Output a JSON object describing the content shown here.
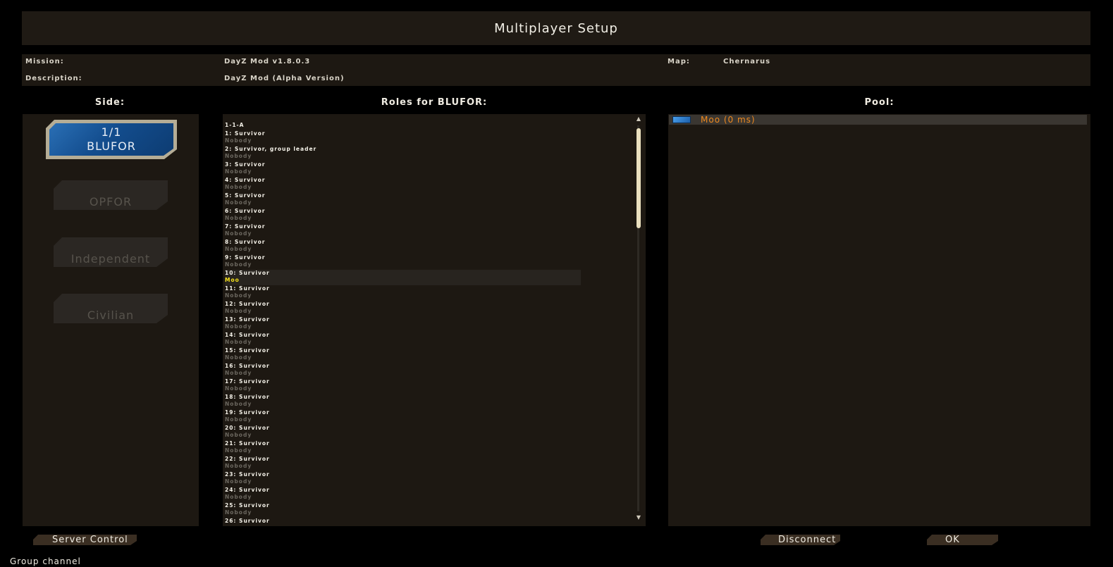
{
  "window": {
    "title": "Multiplayer Setup"
  },
  "info": {
    "mission_label": "Mission:",
    "mission_value": "DayZ Mod v1.8.0.3",
    "description_label": "Description:",
    "description_value": "DayZ Mod (Alpha Version)",
    "map_label": "Map:",
    "map_value": "Chernarus"
  },
  "side_panel": {
    "header": "Side:",
    "blufor": {
      "count": "1/1",
      "label": "BLUFOR"
    },
    "opfor": "OPFOR",
    "independent": "Independent",
    "civilian": "Civilian"
  },
  "roles_panel": {
    "header": "Roles for BLUFOR:",
    "group": "1-1-A",
    "roles": [
      {
        "name": "1: Survivor",
        "player": "Nobody"
      },
      {
        "name": "2: Survivor, group leader",
        "player": "Nobody"
      },
      {
        "name": "3: Survivor",
        "player": "Nobody"
      },
      {
        "name": "4: Survivor",
        "player": "Nobody"
      },
      {
        "name": "5: Survivor",
        "player": "Nobody"
      },
      {
        "name": "6: Survivor",
        "player": "Nobody"
      },
      {
        "name": "7: Survivor",
        "player": "Nobody"
      },
      {
        "name": "8: Survivor",
        "player": "Nobody"
      },
      {
        "name": "9: Survivor",
        "player": "Nobody"
      },
      {
        "name": "10: Survivor",
        "player": "Moo"
      },
      {
        "name": "11: Survivor",
        "player": "Nobody"
      },
      {
        "name": "12: Survivor",
        "player": "Nobody"
      },
      {
        "name": "13: Survivor",
        "player": "Nobody"
      },
      {
        "name": "14: Survivor",
        "player": "Nobody"
      },
      {
        "name": "15: Survivor",
        "player": "Nobody"
      },
      {
        "name": "16: Survivor",
        "player": "Nobody"
      },
      {
        "name": "17: Survivor",
        "player": "Nobody"
      },
      {
        "name": "18: Survivor",
        "player": "Nobody"
      },
      {
        "name": "19: Survivor",
        "player": "Nobody"
      },
      {
        "name": "20: Survivor",
        "player": "Nobody"
      },
      {
        "name": "21: Survivor",
        "player": "Nobody"
      },
      {
        "name": "22: Survivor",
        "player": "Nobody"
      },
      {
        "name": "23: Survivor",
        "player": "Nobody"
      },
      {
        "name": "24: Survivor",
        "player": "Nobody"
      },
      {
        "name": "25: Survivor",
        "player": "Nobody"
      },
      {
        "name": "26: Survivor",
        "player": ""
      }
    ],
    "scroll_up_icon": "▲",
    "scroll_down_icon": "▼"
  },
  "pool_panel": {
    "header": "Pool:",
    "players": [
      {
        "label": "Moo (0 ms)"
      }
    ]
  },
  "buttons": {
    "server_control": "Server Control",
    "disconnect": "Disconnect",
    "ok": "OK"
  },
  "chat": {
    "channel": "Group channel"
  },
  "colors": {
    "background": "#000000",
    "panel": "#1d1812",
    "selected_player": "#f5e11a",
    "pool_player": "#f08a1f",
    "blufor": "#134d8e"
  }
}
